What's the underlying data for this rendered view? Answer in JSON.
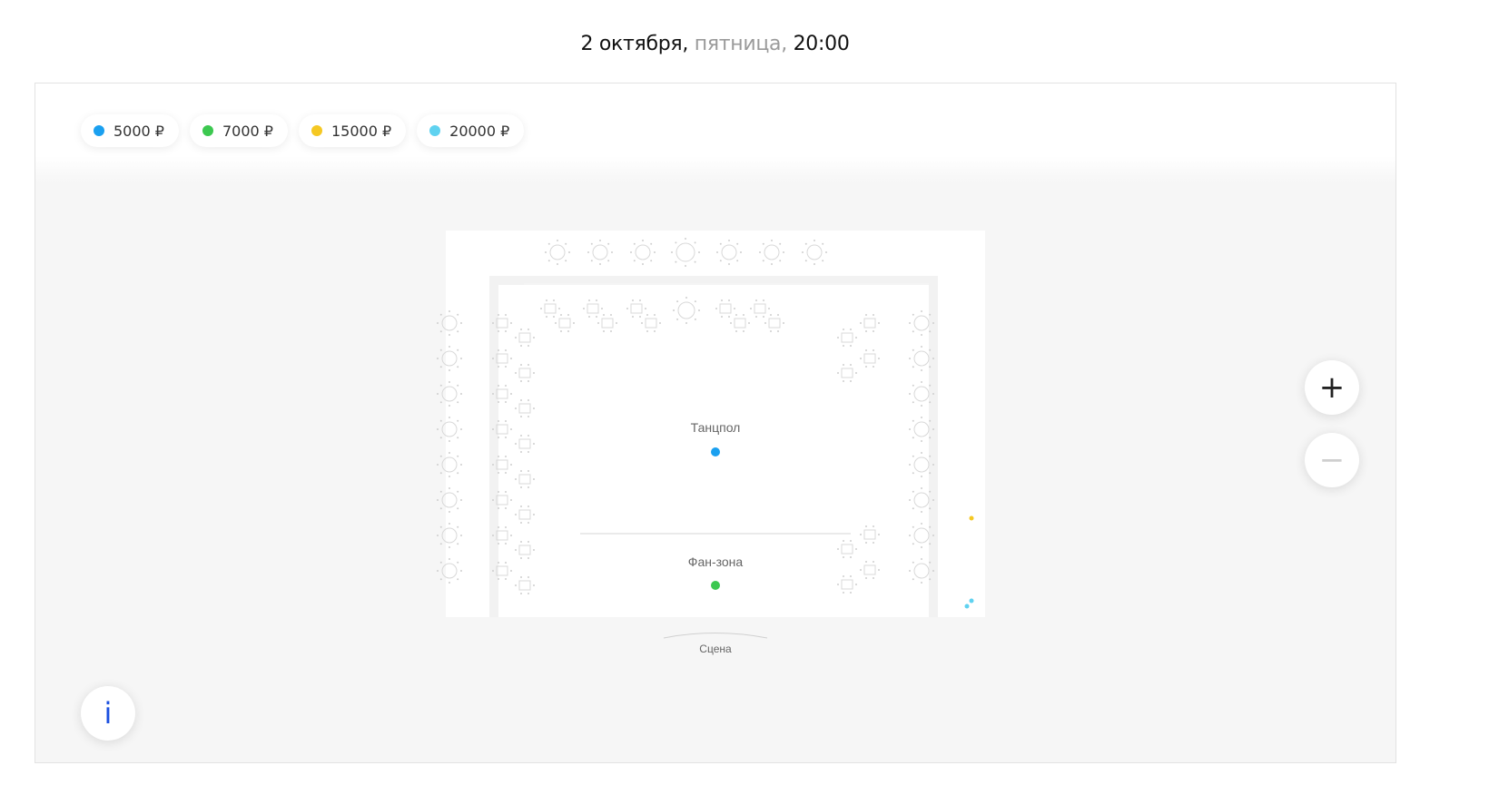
{
  "header": {
    "date": "2 октября,",
    "weekday": "пятница,",
    "time": "20:00"
  },
  "legend": [
    {
      "label": "5000 ₽",
      "color": "#1aa0f0"
    },
    {
      "label": "7000 ₽",
      "color": "#3cc850"
    },
    {
      "label": "15000 ₽",
      "color": "#f5c823"
    },
    {
      "label": "20000 ₽",
      "color": "#5fd2f0"
    }
  ],
  "hall": {
    "dance_floor": "Танцпол",
    "fan_zone": "Фан-зона",
    "stage": "Сцена",
    "dance_floor_color": "#1aa0f0",
    "fan_zone_color": "#3cc850"
  },
  "controls": {
    "zoom_in": "+",
    "zoom_out": "−",
    "info": "i"
  }
}
